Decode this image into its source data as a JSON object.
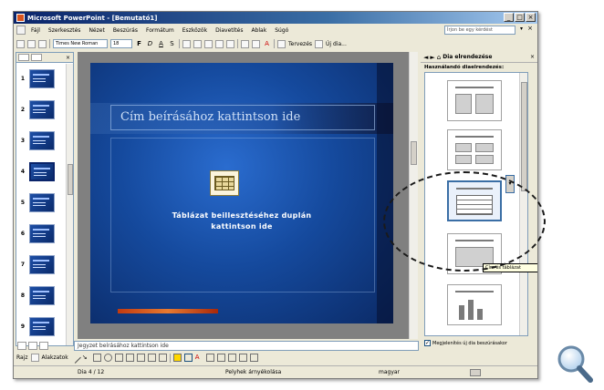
{
  "window": {
    "title": "Microsoft PowerPoint - [Bemutató1]",
    "controls": [
      "_",
      "□",
      "×"
    ]
  },
  "menubar": {
    "items": [
      "Fájl",
      "Szerkesztés",
      "Nézet",
      "Beszúrás",
      "Formátum",
      "Eszközök",
      "Diavetítés",
      "Ablak",
      "Súgó"
    ],
    "help_placeholder": "Írjon be egy kérdést",
    "doc_close": "×"
  },
  "toolbar": {
    "font_name": "Times New Roman",
    "font_size": "18",
    "bold": "F",
    "italic": "D",
    "underline": "A",
    "shadow": "S",
    "font_color": "A",
    "new_slide_label": "Tervezés",
    "new_label": "Új dia..."
  },
  "slide_pane": {
    "tabs": [
      "Diák",
      "Vázlat"
    ],
    "close": "×",
    "slides": [
      {
        "number": "1"
      },
      {
        "number": "2"
      },
      {
        "number": "3"
      },
      {
        "number": "4"
      },
      {
        "number": "5"
      },
      {
        "number": "6"
      },
      {
        "number": "7"
      },
      {
        "number": "8"
      },
      {
        "number": "9"
      }
    ],
    "selected_index": 3
  },
  "slide": {
    "title_placeholder": "Cím beírásához kattintson ide",
    "body_line1": "Táblázat beillesztéséhez duplán",
    "body_line2": "kattintson ide"
  },
  "notes": {
    "text": "Jegyzet beírásához kattintson ide"
  },
  "task_pane": {
    "title": "Dia elrendezése",
    "subtitle": "Használandó diaelrendezés:",
    "tooltip": "Cím és táblázat",
    "footer_checkbox": "Megjelenítés új dia beszúrásakor",
    "checkbox_checked": true,
    "close": "×"
  },
  "draw_toolbar": {
    "draw_label": "Rajz",
    "autoshapes_label": "Alakzatok"
  },
  "statusbar": {
    "slide_position": "Dia 4 / 12",
    "design_name": "Pelyhek árnyékolása",
    "language": "magyar"
  },
  "colors": {
    "titlebar": "#0a246a",
    "slide_background": "#154a9e",
    "window_chrome": "#ece9d8"
  },
  "icons": {
    "app": "powerpoint-icon",
    "zoom": "magnifier-icon"
  }
}
